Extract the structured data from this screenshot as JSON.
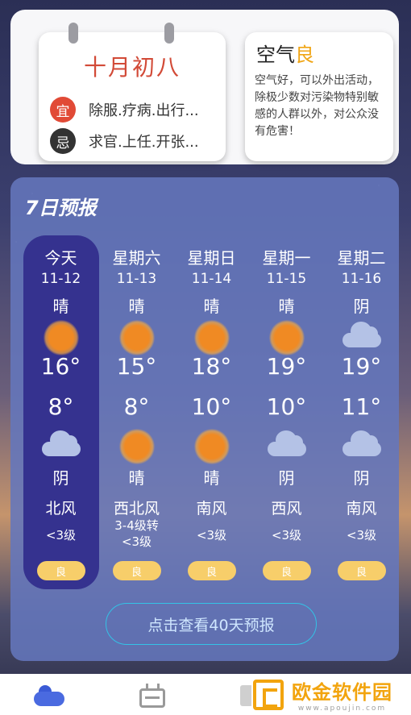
{
  "almanac": {
    "lunar_date": "十月初八",
    "yi_badge": "宜",
    "yi_text": "除服.疗病.出行...",
    "ji_badge": "忌",
    "ji_text": "求官.上任.开张..."
  },
  "air": {
    "title": "空气",
    "level": "良",
    "level_color": "#f0a515",
    "description": "空气好，可以外出活动，除极少数对污染物特别敏感的人群以外，对公众没有危害！"
  },
  "forecast": {
    "title": "7日预报",
    "days": [
      {
        "day": "今天",
        "date": "11-12",
        "weather_day": "晴",
        "icon_day": "sun-icon",
        "high": "16°",
        "low": "8°",
        "icon_night": "cloud-icon",
        "weather_night": "阴",
        "wind": "北风",
        "wind_level": "<3级",
        "aqi": "良"
      },
      {
        "day": "星期六",
        "date": "11-13",
        "weather_day": "晴",
        "icon_day": "sun-icon",
        "high": "15°",
        "low": "8°",
        "icon_night": "sun-icon",
        "weather_night": "晴",
        "wind": "西北风",
        "wind_level": "3-4级转<3级",
        "aqi": "良"
      },
      {
        "day": "星期日",
        "date": "11-14",
        "weather_day": "晴",
        "icon_day": "sun-icon",
        "high": "18°",
        "low": "10°",
        "icon_night": "sun-icon",
        "weather_night": "晴",
        "wind": "南风",
        "wind_level": "<3级",
        "aqi": "良"
      },
      {
        "day": "星期一",
        "date": "11-15",
        "weather_day": "晴",
        "icon_day": "sun-icon",
        "high": "19°",
        "low": "10°",
        "icon_night": "cloud-icon",
        "weather_night": "阴",
        "wind": "西风",
        "wind_level": "<3级",
        "aqi": "良"
      },
      {
        "day": "星期二",
        "date": "11-16",
        "weather_day": "阴",
        "icon_day": "cloud-icon",
        "high": "19°",
        "low": "11°",
        "icon_night": "cloud-icon",
        "weather_night": "阴",
        "wind": "南风",
        "wind_level": "<3级",
        "aqi": "良"
      }
    ],
    "more_button": "点击查看40天预报"
  },
  "bottom_nav": {
    "items": [
      "weather-icon",
      "calendar-icon",
      "more-icon"
    ]
  },
  "watermark": {
    "name": "欧金软件园",
    "url": "www.apoujin.com"
  },
  "colors": {
    "accent_red": "#d24a37",
    "today_highlight": "#35328f",
    "panel": "#6476bc",
    "aqi_badge": "#f7ce6a",
    "button_border": "#33c3e6"
  }
}
